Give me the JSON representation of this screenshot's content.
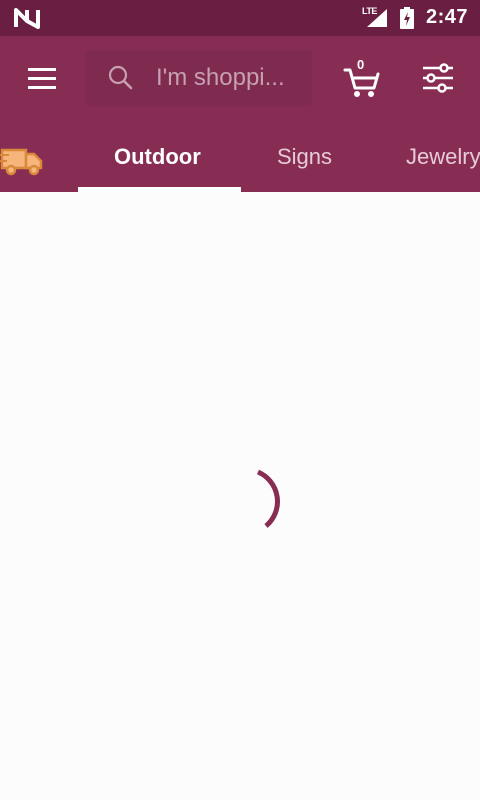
{
  "status_bar": {
    "network_type": "LTE",
    "time": "2:47"
  },
  "app_bar": {
    "search": {
      "placeholder": "I'm shoppi..."
    },
    "cart": {
      "count": "0"
    },
    "icons": {
      "menu": "hamburger-menu-icon",
      "search": "search-icon",
      "cart": "shopping-cart-icon",
      "filter": "sliders-filter-icon",
      "delivery": "delivery-truck-icon"
    }
  },
  "tabs": {
    "items": [
      {
        "label": "Outdoor",
        "active": true
      },
      {
        "label": "Signs",
        "active": false
      },
      {
        "label": "Jewelry",
        "active": false
      }
    ]
  },
  "main": {
    "loading": true
  },
  "colors": {
    "status_bar": "#6a1f42",
    "app_bar": "#872c53",
    "search_box": "#7f2a4f",
    "spinner": "#872c53",
    "truck_fill": "#f6b57a",
    "truck_stroke": "#d9893a",
    "background": "#fdfcfd"
  }
}
